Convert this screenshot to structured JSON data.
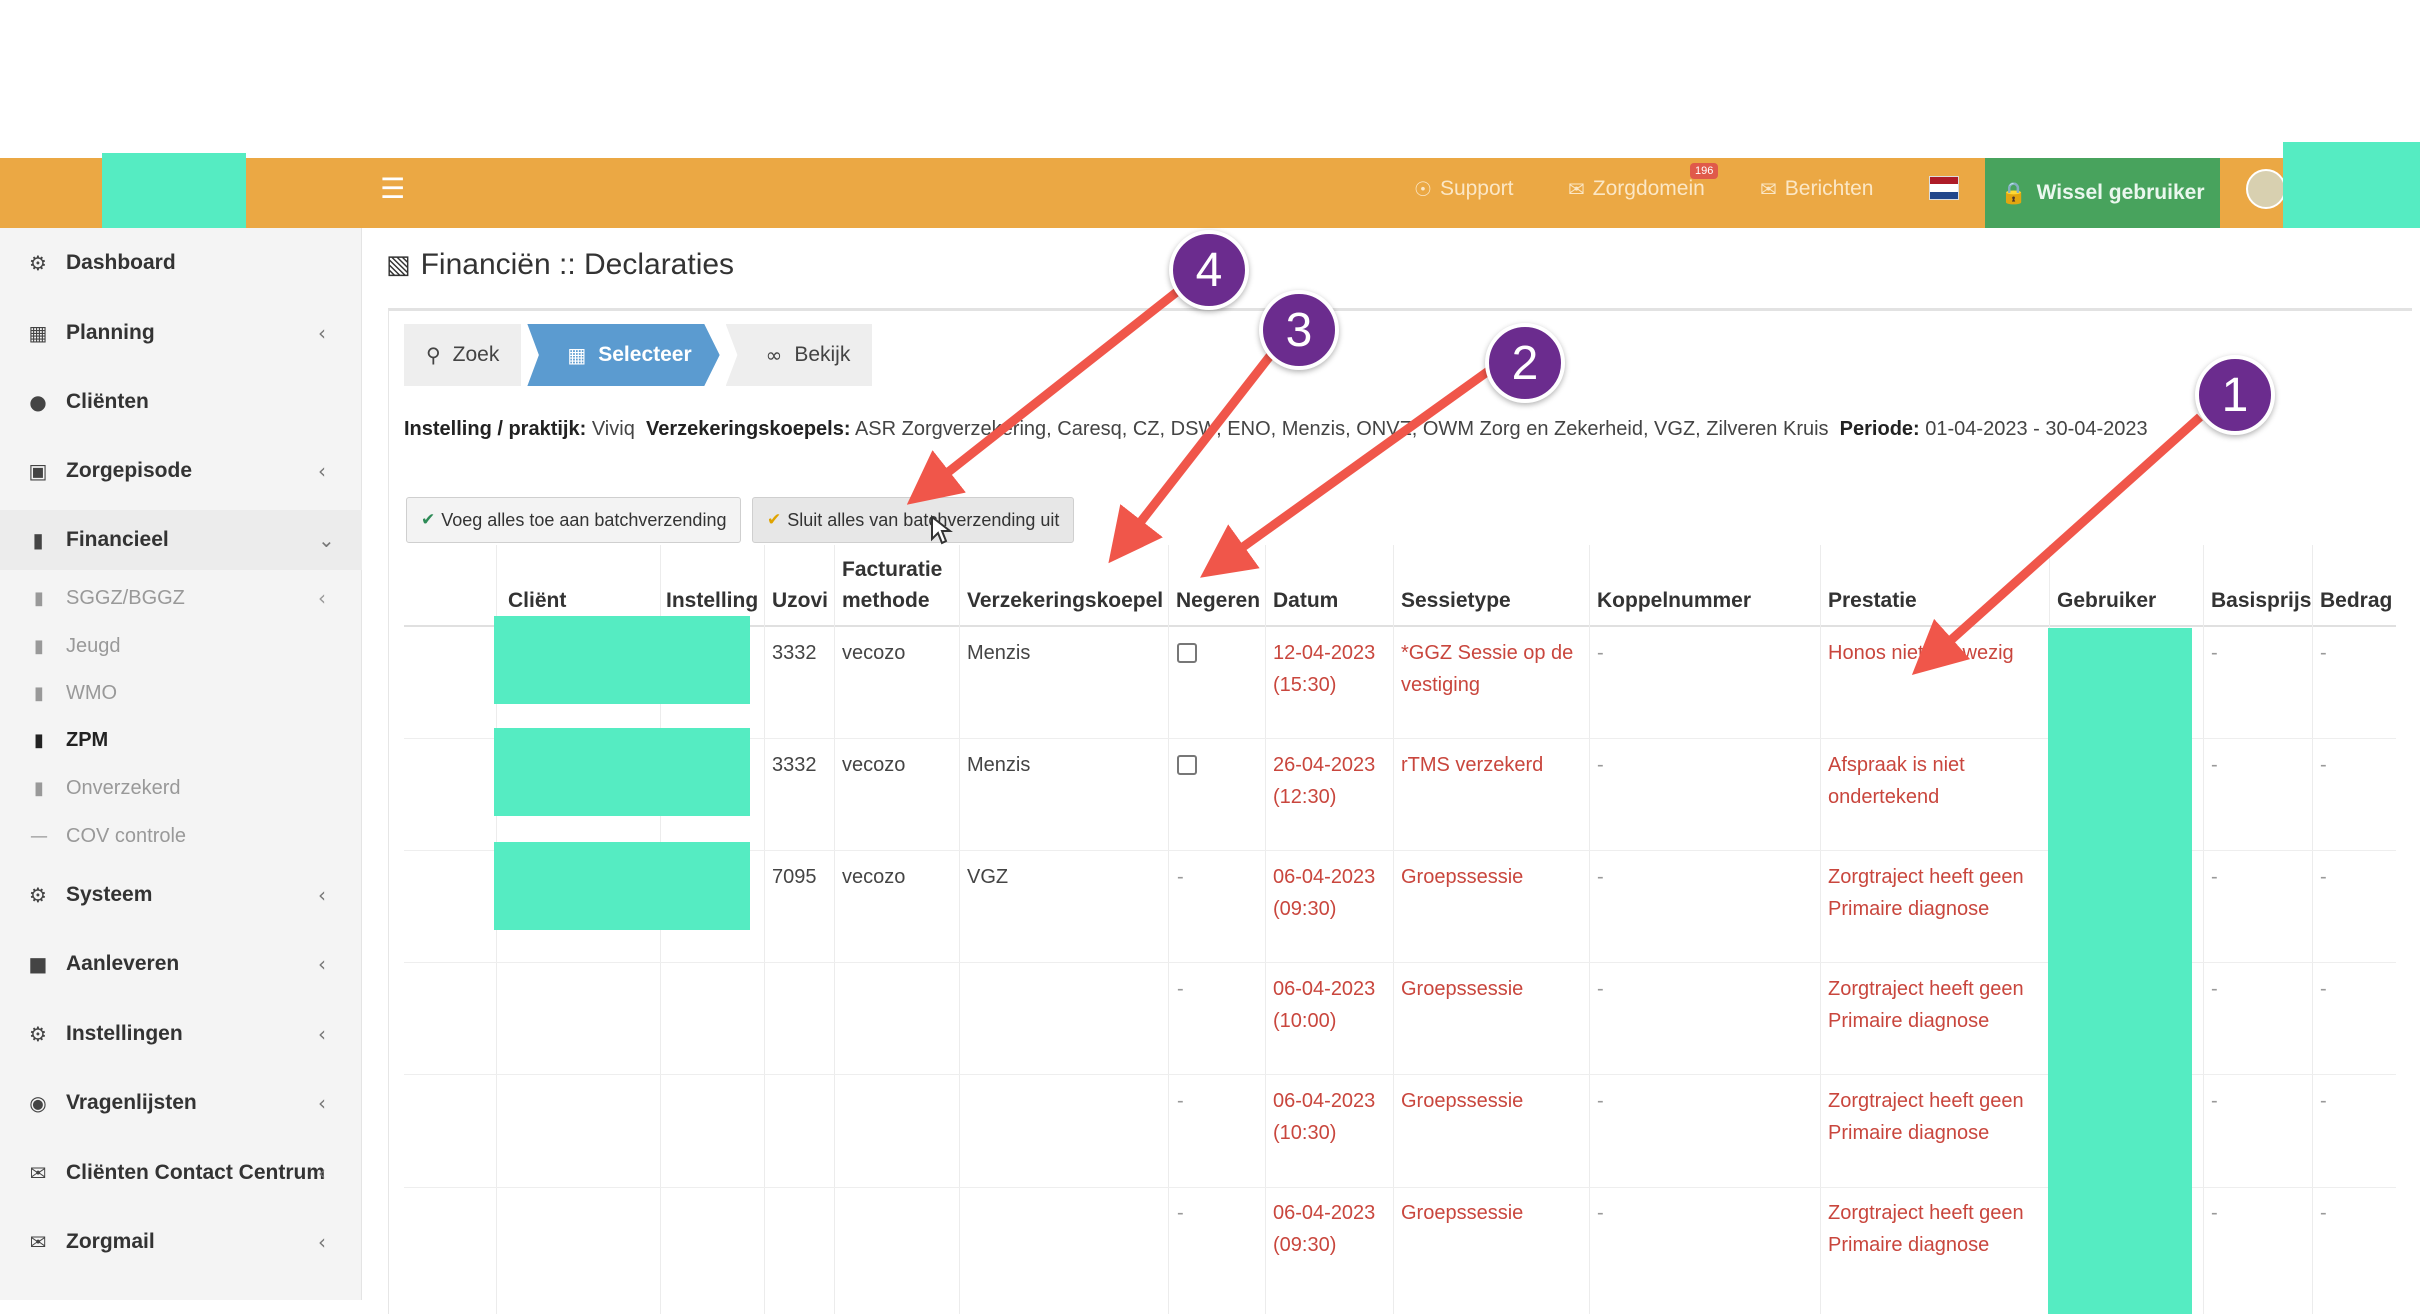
{
  "topbar": {
    "menu_icon": "hamburger-icon",
    "support": "Support",
    "zorgdomein": "Zorgdomein",
    "zorgdomein_badge": "196",
    "berichten": "Berichten",
    "switch_user": "Wissel gebruiker",
    "colors": {
      "bar": "#eba844",
      "switch_user": "#48a35d"
    }
  },
  "sidebar": {
    "items": [
      {
        "label": "Dashboard",
        "icon": "dashboard-icon"
      },
      {
        "label": "Planning",
        "icon": "calendar-icon"
      },
      {
        "label": "Cliënten",
        "icon": "user-icon"
      },
      {
        "label": "Zorgepisode",
        "icon": "briefcase-icon"
      },
      {
        "label": "Financieel",
        "icon": "book-icon"
      },
      {
        "label": "Systeem",
        "icon": "cogs-icon"
      },
      {
        "label": "Aanleveren",
        "icon": "truck-icon"
      },
      {
        "label": "Instellingen",
        "icon": "gear-icon"
      },
      {
        "label": "Vragenlijsten",
        "icon": "globe-icon"
      },
      {
        "label": "Cliënten Contact Centrum",
        "icon": "envelope-icon"
      },
      {
        "label": "Zorgmail",
        "icon": "envelope-icon"
      }
    ],
    "sub_items": [
      {
        "label": "SGGZ/BGGZ"
      },
      {
        "label": "Jeugd"
      },
      {
        "label": "WMO"
      },
      {
        "label": "ZPM"
      },
      {
        "label": "Onverzekerd"
      },
      {
        "label": "COV controle"
      }
    ]
  },
  "page": {
    "title": "Financiën :: Declaraties",
    "wizard": [
      "Zoek",
      "Selecteer",
      "Bekijk"
    ],
    "info": {
      "instelling_label": "Instelling / praktijk:",
      "instelling_value": "Viviq",
      "koepels_label": "Verzekeringskoepels:",
      "koepels_value": "ASR Zorgverzekering, Caresq, CZ, DSW, ENO, Menzis, ONVZ, OWM Zorg en Zekerheid, VGZ, Zilveren Kruis",
      "periode_label": "Periode:",
      "periode_value": "01-04-2023 - 30-04-2023"
    },
    "buttons": {
      "add_all": "Voeg alles toe aan batchverzending",
      "exclude_all": "Sluit alles van batchverzending uit"
    }
  },
  "table": {
    "headers": {
      "client": "Cliënt",
      "instelling": "Instelling",
      "uzovi": "Uzovi",
      "facturatie_1": "Facturatie",
      "facturatie_2": "methode",
      "koepel": "Verzekeringskoepel",
      "negeren": "Negeren",
      "datum": "Datum",
      "sessietype": "Sessietype",
      "koppelnummer": "Koppelnummer",
      "prestatie": "Prestatie",
      "gebruiker": "Gebruiker",
      "basisprijs": "Basisprijs",
      "bedrag": "Bedrag"
    },
    "rows": [
      {
        "uzovi": "3332",
        "methode": "vecozo",
        "koepel": "Menzis",
        "negeren": "checkbox",
        "datum": "12-04-2023",
        "tijd": "(15:30)",
        "sessie_1": "*GGZ Sessie op de",
        "sessie_2": "vestiging",
        "koppel": "-",
        "prestatie_1": "Honos niet aanwezig",
        "prestatie_2": "",
        "basisprijs": "-",
        "bedrag": "-"
      },
      {
        "uzovi": "3332",
        "methode": "vecozo",
        "koepel": "Menzis",
        "negeren": "checkbox",
        "datum": "26-04-2023",
        "tijd": "(12:30)",
        "sessie_1": "rTMS verzekerd",
        "sessie_2": "",
        "koppel": "-",
        "prestatie_1": "Afspraak is niet",
        "prestatie_2": "ondertekend",
        "basisprijs": "-",
        "bedrag": "-"
      },
      {
        "uzovi": "7095",
        "methode": "vecozo",
        "koepel": "VGZ",
        "negeren": "-",
        "datum": "06-04-2023",
        "tijd": "(09:30)",
        "sessie_1": "Groepssessie",
        "sessie_2": "",
        "koppel": "-",
        "prestatie_1": "Zorgtraject heeft geen",
        "prestatie_2": "Primaire diagnose",
        "basisprijs": "-",
        "bedrag": "-"
      },
      {
        "uzovi": "",
        "methode": "",
        "koepel": "",
        "negeren": "-",
        "datum": "06-04-2023",
        "tijd": "(10:00)",
        "sessie_1": "Groepssessie",
        "sessie_2": "",
        "koppel": "-",
        "prestatie_1": "Zorgtraject heeft geen",
        "prestatie_2": "Primaire diagnose",
        "basisprijs": "-",
        "bedrag": "-"
      },
      {
        "uzovi": "",
        "methode": "",
        "koepel": "",
        "negeren": "-",
        "datum": "06-04-2023",
        "tijd": "(10:30)",
        "sessie_1": "Groepssessie",
        "sessie_2": "",
        "koppel": "-",
        "prestatie_1": "Zorgtraject heeft geen",
        "prestatie_2": "Primaire diagnose",
        "basisprijs": "-",
        "bedrag": "-"
      },
      {
        "uzovi": "",
        "methode": "",
        "koepel": "",
        "negeren": "-",
        "datum": "06-04-2023",
        "tijd": "(09:30)",
        "sessie_1": "Groepssessie",
        "sessie_2": "",
        "koppel": "-",
        "prestatie_1": "Zorgtraject heeft geen",
        "prestatie_2": "Primaire diagnose",
        "basisprijs": "-",
        "bedrag": "-"
      }
    ]
  },
  "annotations": {
    "markers": [
      "1",
      "2",
      "3",
      "4"
    ],
    "colors": {
      "marker": "#6b2c8e",
      "arrow": "#f0564a",
      "redaction": "#55ecc2"
    }
  }
}
